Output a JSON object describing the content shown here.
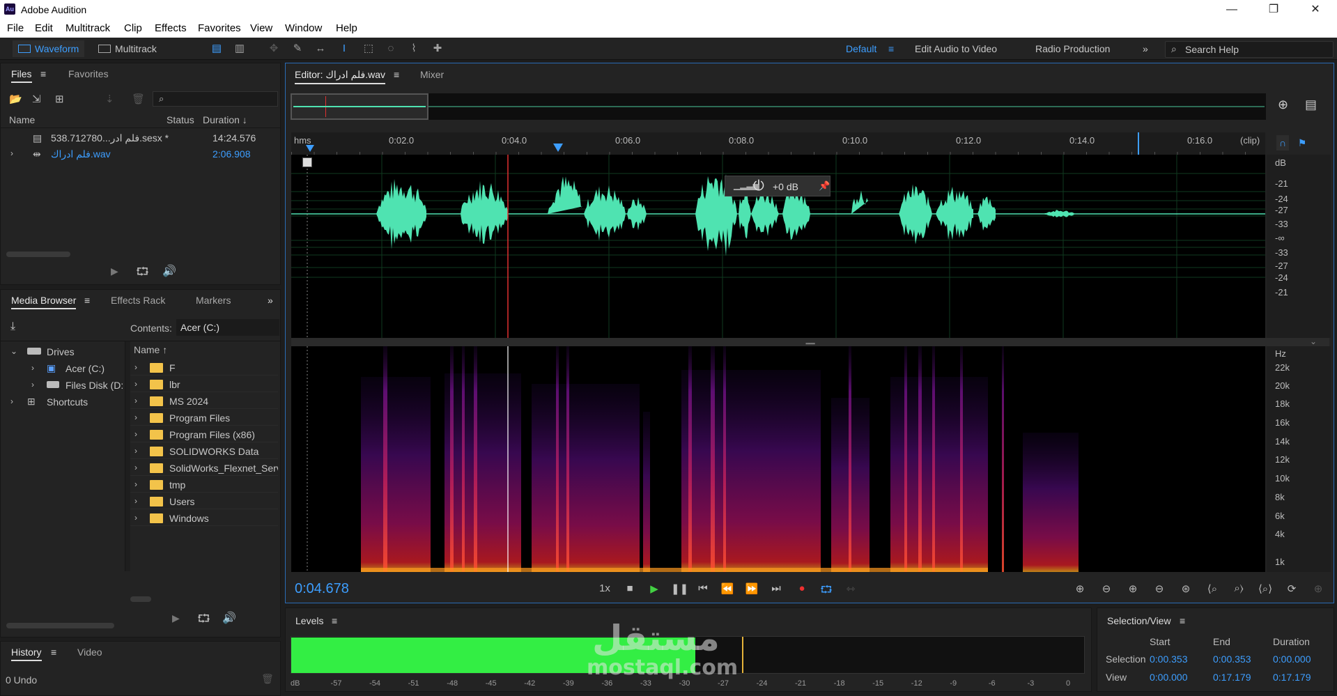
{
  "app": {
    "icon_text": "Au",
    "title": "Adobe Audition"
  },
  "window_controls": {
    "minimize": "—",
    "restore": "❐",
    "close": "✕"
  },
  "menu": [
    "File",
    "Edit",
    "Multitrack",
    "Clip",
    "Effects",
    "Favorites",
    "View",
    "Window",
    "Help"
  ],
  "toolbar": {
    "waveform_label": "Waveform",
    "multitrack_label": "Multitrack",
    "workspaces": {
      "default": "Default",
      "edit_audio_video": "Edit Audio to Video",
      "radio_production": "Radio Production"
    },
    "search_placeholder": "Search Help"
  },
  "files_panel": {
    "tabs": {
      "files": "Files",
      "favorites": "Favorites"
    },
    "columns": {
      "name": "Name",
      "status": "Status",
      "duration": "Duration ↓"
    },
    "rows": [
      {
        "name": "538.712780...فلم ادر.sesx *",
        "duration": "14:24.576"
      },
      {
        "name": "فلم ادراك.wav",
        "duration": "2:06.908"
      }
    ]
  },
  "media_browser": {
    "tabs": {
      "media_browser": "Media Browser",
      "effects_rack": "Effects Rack",
      "markers": "Markers"
    },
    "contents_label": "Contents:",
    "contents_value": "Acer (C:)",
    "tree": {
      "drives": "Drives",
      "acer": "Acer (C:)",
      "files_disk": "Files Disk (D:",
      "shortcuts": "Shortcuts"
    },
    "name_header": "Name",
    "folders": [
      "F",
      "lbr",
      "MS 2024",
      "Program Files",
      "Program Files (x86)",
      "SOLIDWORKS Data",
      "SolidWorks_Flexnet_Serv",
      "tmp",
      "Users",
      "Windows"
    ]
  },
  "history_panel": {
    "tabs": {
      "history": "History",
      "video": "Video"
    },
    "status": "0 Undo"
  },
  "editor": {
    "tab_label": "Editor: فلم ادراك.wav",
    "mixer_label": "Mixer",
    "ruler": {
      "unit": "hms",
      "ticks": [
        "0:02.0",
        "0:04.0",
        "0:06.0",
        "0:08.0",
        "0:10.0",
        "0:12.0",
        "0:14.0",
        "0:16.0"
      ],
      "clip": "(clip)"
    },
    "hud_gain": "+0 dB",
    "db_scale": [
      "dB",
      "-21",
      "-24",
      "-27",
      "-33",
      "-∞",
      "-33",
      "-27",
      "-24",
      "-21"
    ],
    "hz_scale": [
      "Hz",
      "22k",
      "20k",
      "18k",
      "16k",
      "14k",
      "12k",
      "10k",
      "8k",
      "6k",
      "4k",
      "1k"
    ],
    "current_time": "0:04.678",
    "speed": "1x"
  },
  "levels_panel": {
    "title": "Levels",
    "level_fraction": 0.51,
    "ticks": [
      "dB",
      "-57",
      "-54",
      "-51",
      "-48",
      "-45",
      "-42",
      "-39",
      "-36",
      "-33",
      "-30",
      "-27",
      "-24",
      "-21",
      "-18",
      "-15",
      "-12",
      "-9",
      "-6",
      "-3",
      "0"
    ],
    "watermark_ar": "مستقل",
    "watermark_en": "mostaql.com"
  },
  "selection_view": {
    "title": "Selection/View",
    "headers": {
      "start": "Start",
      "end": "End",
      "duration": "Duration"
    },
    "selection": {
      "label": "Selection",
      "start": "0:00.353",
      "end": "0:00.353",
      "duration": "0:00.000"
    },
    "view": {
      "label": "View",
      "start": "0:00.000",
      "end": "0:17.179",
      "duration": "0:17.179"
    }
  },
  "colors": {
    "accent": "#3d9eff",
    "waveform": "#4fe3b1",
    "level_green": "#33ee44",
    "playhead": "#e03030"
  }
}
